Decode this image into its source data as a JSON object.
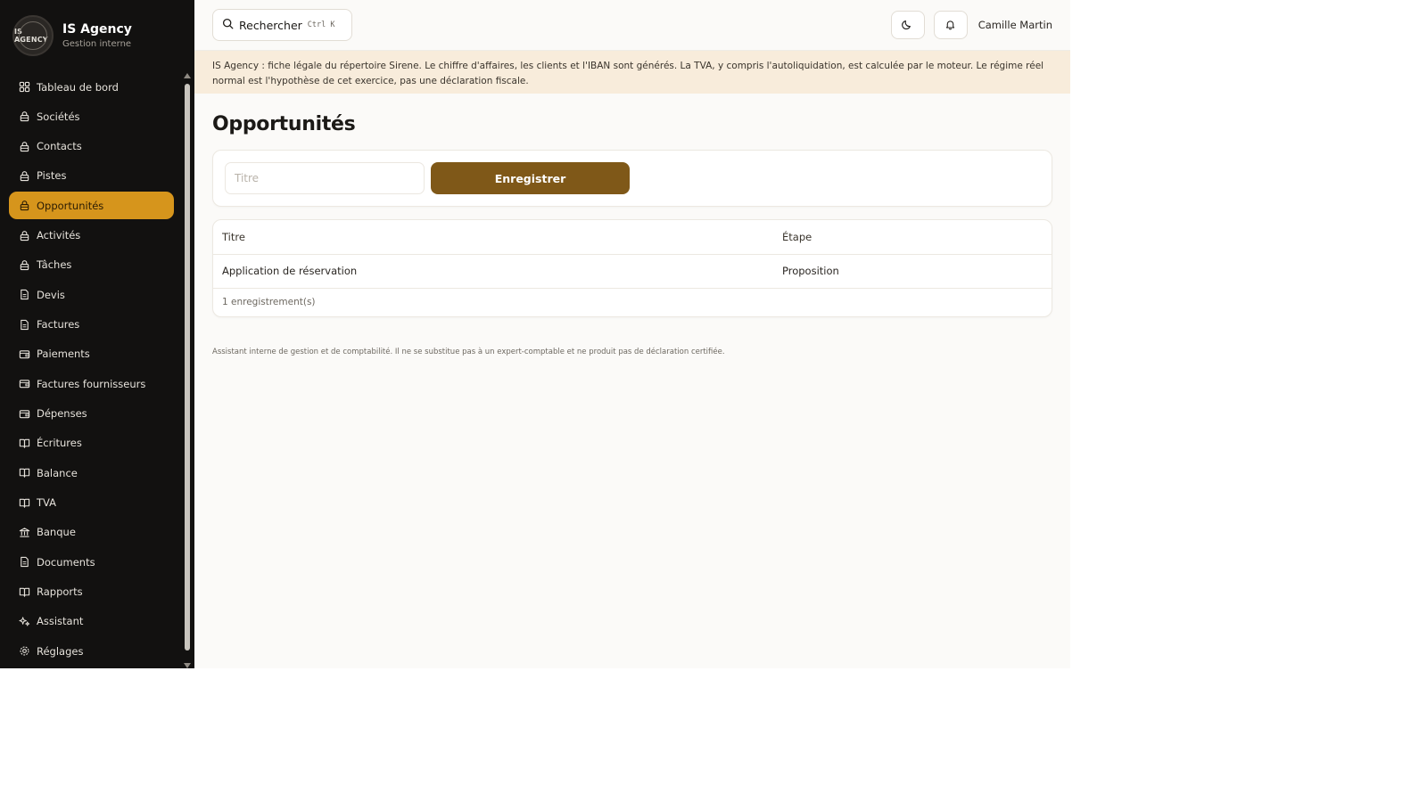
{
  "brand": {
    "logo_text": "IS AGENCY",
    "name": "IS Agency",
    "subtitle": "Gestion interne"
  },
  "sidebar": {
    "items": [
      {
        "label": "Tableau de bord",
        "icon": "dashboard-icon"
      },
      {
        "label": "Sociétés",
        "icon": "lock-icon"
      },
      {
        "label": "Contacts",
        "icon": "lock-icon"
      },
      {
        "label": "Pistes",
        "icon": "lock-icon"
      },
      {
        "label": "Opportunités",
        "icon": "lock-icon",
        "active": true
      },
      {
        "label": "Activités",
        "icon": "lock-icon"
      },
      {
        "label": "Tâches",
        "icon": "lock-icon"
      },
      {
        "label": "Devis",
        "icon": "document-icon"
      },
      {
        "label": "Factures",
        "icon": "document-icon"
      },
      {
        "label": "Paiements",
        "icon": "wallet-icon"
      },
      {
        "label": "Factures fournisseurs",
        "icon": "wallet-icon"
      },
      {
        "label": "Dépenses",
        "icon": "wallet-icon"
      },
      {
        "label": "Écritures",
        "icon": "book-icon"
      },
      {
        "label": "Balance",
        "icon": "book-icon"
      },
      {
        "label": "TVA",
        "icon": "book-icon"
      },
      {
        "label": "Banque",
        "icon": "bank-icon"
      },
      {
        "label": "Documents",
        "icon": "document-icon"
      },
      {
        "label": "Rapports",
        "icon": "book-icon"
      },
      {
        "label": "Assistant",
        "icon": "sparkle-icon"
      },
      {
        "label": "Réglages",
        "icon": "gear-icon"
      }
    ]
  },
  "topbar": {
    "search_label": "Rechercher",
    "search_shortcut": "Ctrl K",
    "user_name": "Camille Martin"
  },
  "banner": {
    "text": "IS Agency : fiche légale du répertoire Sirene. Le chiffre d'affaires, les clients et l'IBAN sont générés. La TVA, y compris l'autoliquidation, est calculée par le moteur. Le régime réel normal est l'hypothèse de cet exercice, pas une déclaration fiscale."
  },
  "page": {
    "title": "Opportunités"
  },
  "form": {
    "title_placeholder": "Titre",
    "save_label": "Enregistrer"
  },
  "table": {
    "headers": [
      "Titre",
      "Étape"
    ],
    "rows": [
      [
        "Application de réservation",
        "Proposition"
      ]
    ],
    "footer": "1 enregistrement(s)"
  },
  "disclaimer": "Assistant interne de gestion et de comptabilité. Il ne se substitue pas à un expert-comptable et ne produit pas de déclaration certifiée.",
  "colors": {
    "sidebar_bg": "#121110",
    "active_item": "#d6951c",
    "primary_button": "#7f5818",
    "banner_bg": "#f8ecdb"
  }
}
